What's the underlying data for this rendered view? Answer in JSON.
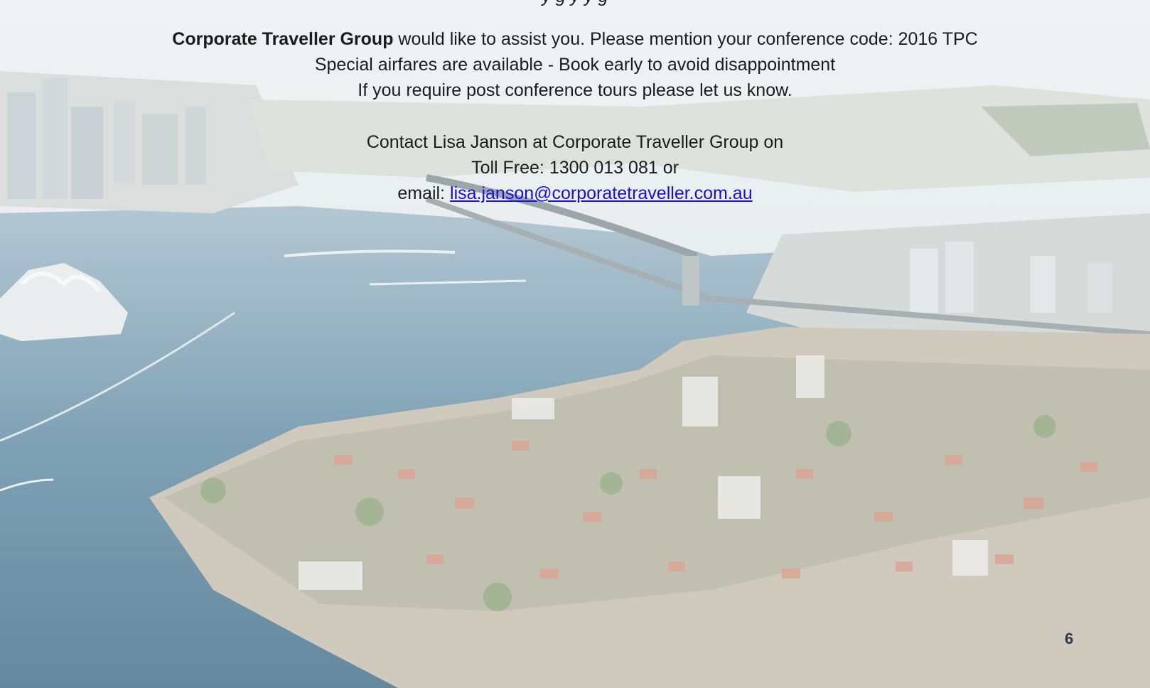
{
  "header_cutoff": "y      g       y     y                                                           g",
  "assist_line": {
    "company": "Corporate Traveller Group",
    "text": " would like to assist you. Please mention your conference code: 2016 TPC"
  },
  "special_airfares": "Special airfares are available - Book early to avoid disappointment",
  "post_conference": "If you require post conference tours please let us know.",
  "contact_line": "Contact Lisa Janson at Corporate Traveller Group on",
  "toll_free": "Toll Free: 1300 013 081 or",
  "email_label": "email: ",
  "email_address": "lisa.janson@corporatetraveller.com.au ",
  "page_number": "6",
  "colors": {
    "link": "#1a0dd9",
    "text": "#1c1c1c",
    "water": "#5f8aa3"
  }
}
